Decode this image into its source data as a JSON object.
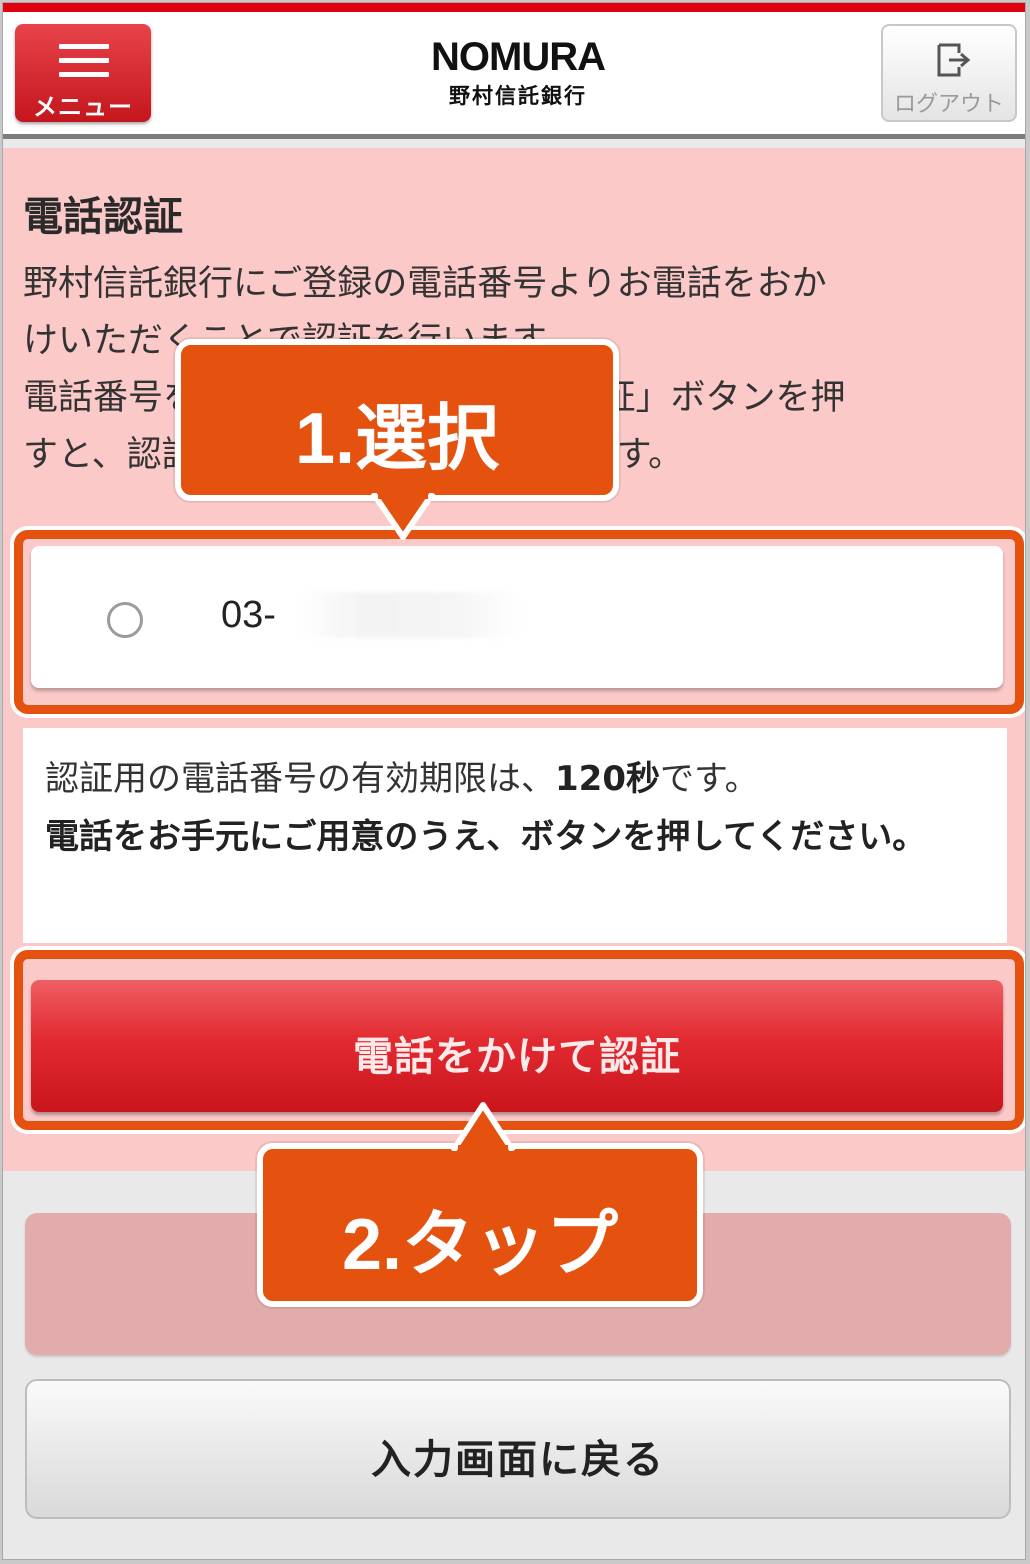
{
  "header": {
    "menu_label": "メニュー",
    "brand_name": "NOMURA",
    "brand_subtitle": "野村信託銀行",
    "logout_label": "ログアウト"
  },
  "section": {
    "title": "電話認証",
    "description_lines": [
      "野村信託銀行にご登録の電話番号よりお電話をおか",
      "けいただくことで認証を行います。",
      "電話番号を選択し、「電話をかけて認証」ボタンを押",
      "すと、認証用の電話番号が表示されます。"
    ]
  },
  "phone_option": {
    "number_visible": "03-",
    "selected": false
  },
  "notice": {
    "line1_pre": "認証用の電話番号の有効期限は、",
    "line1_bold": "120秒",
    "line1_post": "です。",
    "line2_bold": "電話をお手元にご用意のうえ、ボタンを押してください。"
  },
  "buttons": {
    "call_label": "電話をかけて認証",
    "back_label": "入力画面に戻る"
  },
  "annotations": {
    "step1": "1.選択",
    "step2": "2.タップ",
    "accent_color": "#e55210"
  },
  "colors": {
    "brand_red": "#e0000f",
    "panel_pink": "#fcc9c9"
  },
  "icons": {
    "menu": "hamburger-icon",
    "logout": "logout-icon",
    "radio": "radio-unchecked-icon"
  }
}
